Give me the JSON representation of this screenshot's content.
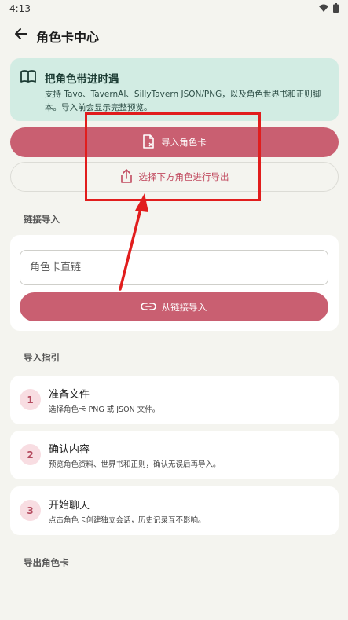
{
  "status_bar": {
    "time": "4:13"
  },
  "app_bar": {
    "title": "角色卡中心"
  },
  "info_card": {
    "title": "把角色带进时遇",
    "description": "支持 Tavo、TavernAI、SillyTavern JSON/PNG，以及角色世界书和正则脚本。导入前会显示完整预览。"
  },
  "actions": {
    "import_label": "导入角色卡",
    "export_label": "选择下方角色进行导出"
  },
  "link_section": {
    "label": "链接导入",
    "input_placeholder": "角色卡直链",
    "button_label": "从链接导入"
  },
  "guide_section": {
    "label": "导入指引",
    "steps": [
      {
        "number": "1",
        "title": "准备文件",
        "description": "选择角色卡 PNG 或 JSON 文件。"
      },
      {
        "number": "2",
        "title": "确认内容",
        "description": "预览角色资料、世界书和正则，确认无误后再导入。"
      },
      {
        "number": "3",
        "title": "开始聊天",
        "description": "点击角色卡创建独立会话，历史记录互不影响。"
      }
    ]
  },
  "export_section": {
    "label": "导出角色卡"
  },
  "colors": {
    "accent": "#c95f71",
    "info_bg": "#d2ece3",
    "annotation": "#e11d1d"
  },
  "icons": {
    "back": "arrow-left-icon",
    "book": "open-book-icon",
    "import": "file-import-icon",
    "export": "share-upload-icon",
    "link": "link-icon",
    "wifi": "wifi-icon",
    "battery": "battery-icon"
  }
}
